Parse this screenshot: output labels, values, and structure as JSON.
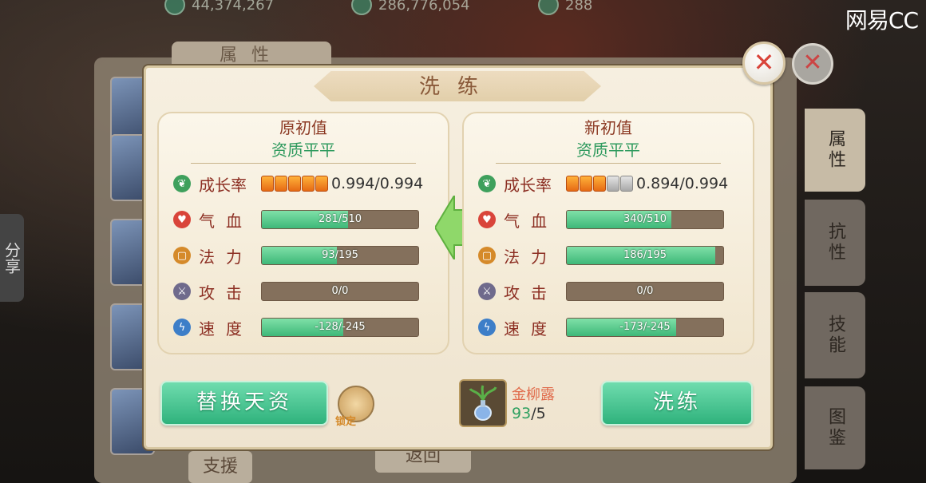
{
  "watermark": "网易CC",
  "top_resources": [
    "44,374,267",
    "286,776,054",
    "288"
  ],
  "background": {
    "attr_tab": "属性",
    "right_tabs": [
      "属性",
      "抗性",
      "技能",
      "图鉴"
    ],
    "share": "分享",
    "bottom_left_btn": "支援",
    "bottom_mid_btn": "返回",
    "close_symbol": "✕"
  },
  "dialog": {
    "title": "洗练",
    "close_symbol": "✕",
    "left": {
      "title": "原初值",
      "quality": "资质平平",
      "growth": {
        "label": "成长率",
        "value": "0.994/0.994",
        "filled": 5,
        "total": 5
      },
      "stats": [
        {
          "label": "气血",
          "text": "281/510",
          "fill": 0.55,
          "icon": "heart-icon"
        },
        {
          "label": "法力",
          "text": "93/195",
          "fill": 0.48,
          "icon": "mana-icon"
        },
        {
          "label": "攻击",
          "text": "0/0",
          "fill": 0.0,
          "icon": "sword-icon"
        },
        {
          "label": "速度",
          "text": "-128/-245",
          "fill": 0.52,
          "icon": "lightning-icon"
        }
      ]
    },
    "right": {
      "title": "新初值",
      "quality": "资质平平",
      "growth": {
        "label": "成长率",
        "value": "0.894/0.994",
        "filled": 3,
        "total": 5
      },
      "stats": [
        {
          "label": "气血",
          "text": "340/510",
          "fill": 0.67,
          "icon": "heart-icon"
        },
        {
          "label": "法力",
          "text": "186/195",
          "fill": 0.95,
          "icon": "mana-icon"
        },
        {
          "label": "攻击",
          "text": "0/0",
          "fill": 0.0,
          "icon": "sword-icon"
        },
        {
          "label": "速度",
          "text": "-173/-245",
          "fill": 0.7,
          "icon": "lightning-icon"
        }
      ]
    },
    "replace_button": "替换天资",
    "lock_text": "锁定",
    "item": {
      "name": "金柳露",
      "have": "93",
      "need": "/5"
    },
    "refine_button": "洗练"
  }
}
